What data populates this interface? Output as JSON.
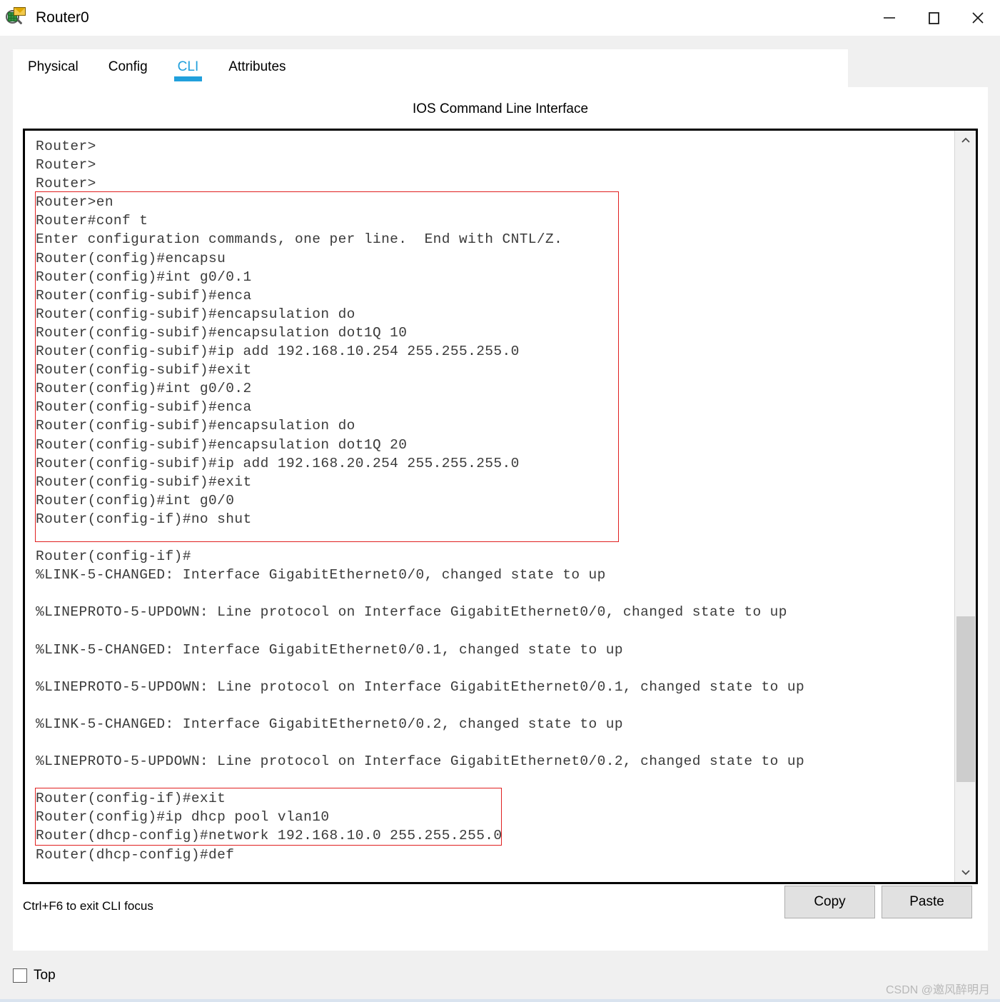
{
  "window": {
    "title": "Router0",
    "icon": "inspect-magnifier-icon",
    "controls": {
      "minimize": "minimize-icon",
      "maximize": "maximize-icon",
      "close": "close-icon"
    }
  },
  "tabs": [
    {
      "label": "Physical",
      "active": false
    },
    {
      "label": "Config",
      "active": false
    },
    {
      "label": "CLI",
      "active": true
    },
    {
      "label": "Attributes",
      "active": false
    }
  ],
  "panel": {
    "title": "IOS Command Line Interface"
  },
  "terminal": {
    "lines": [
      "Router>",
      "Router>",
      "Router>",
      "Router>en",
      "Router#conf t",
      "Enter configuration commands, one per line.  End with CNTL/Z.",
      "Router(config)#encapsu",
      "Router(config)#int g0/0.1",
      "Router(config-subif)#enca",
      "Router(config-subif)#encapsulation do",
      "Router(config-subif)#encapsulation dot1Q 10",
      "Router(config-subif)#ip add 192.168.10.254 255.255.255.0",
      "Router(config-subif)#exit",
      "Router(config)#int g0/0.2",
      "Router(config-subif)#enca",
      "Router(config-subif)#encapsulation do",
      "Router(config-subif)#encapsulation dot1Q 20",
      "Router(config-subif)#ip add 192.168.20.254 255.255.255.0",
      "Router(config-subif)#exit",
      "Router(config)#int g0/0",
      "Router(config-if)#no shut",
      "",
      "Router(config-if)#",
      "%LINK-5-CHANGED: Interface GigabitEthernet0/0, changed state to up",
      "",
      "%LINEPROTO-5-UPDOWN: Line protocol on Interface GigabitEthernet0/0, changed state to up",
      "",
      "%LINK-5-CHANGED: Interface GigabitEthernet0/0.1, changed state to up",
      "",
      "%LINEPROTO-5-UPDOWN: Line protocol on Interface GigabitEthernet0/0.1, changed state to up",
      "",
      "%LINK-5-CHANGED: Interface GigabitEthernet0/0.2, changed state to up",
      "",
      "%LINEPROTO-5-UPDOWN: Line protocol on Interface GigabitEthernet0/0.2, changed state to up",
      "",
      "Router(config-if)#exit",
      "Router(config)#ip dhcp pool vlan10",
      "Router(dhcp-config)#network 192.168.10.0 255.255.255.0",
      "Router(dhcp-config)#def"
    ],
    "annotation_color": "#e02020",
    "annotations": [
      {
        "name": "subinterface-config-highlight",
        "first_line": "Router>en",
        "last_line": "Router(config-if)#no shut"
      },
      {
        "name": "dhcp-pool-highlight",
        "first_line": "Router(config-if)#exit",
        "last_line": "Router(dhcp-config)#network 192.168.10.0 255.255.255.0"
      }
    ],
    "scrollbar": {
      "up_arrow": "chevron-up-icon",
      "down_arrow": "chevron-down-icon"
    }
  },
  "footer": {
    "hint": "Ctrl+F6 to exit CLI focus",
    "copy_label": "Copy",
    "paste_label": "Paste"
  },
  "bottom": {
    "top_checkbox_label": "Top",
    "top_checked": false,
    "watermark": "CSDN @邀风醉明月"
  },
  "colors": {
    "accent": "#21a0dc",
    "annotation": "#e02020",
    "window_bg": "#f0f0f0",
    "panel_bg": "#ffffff",
    "terminal_text": "#3a3a3a"
  }
}
